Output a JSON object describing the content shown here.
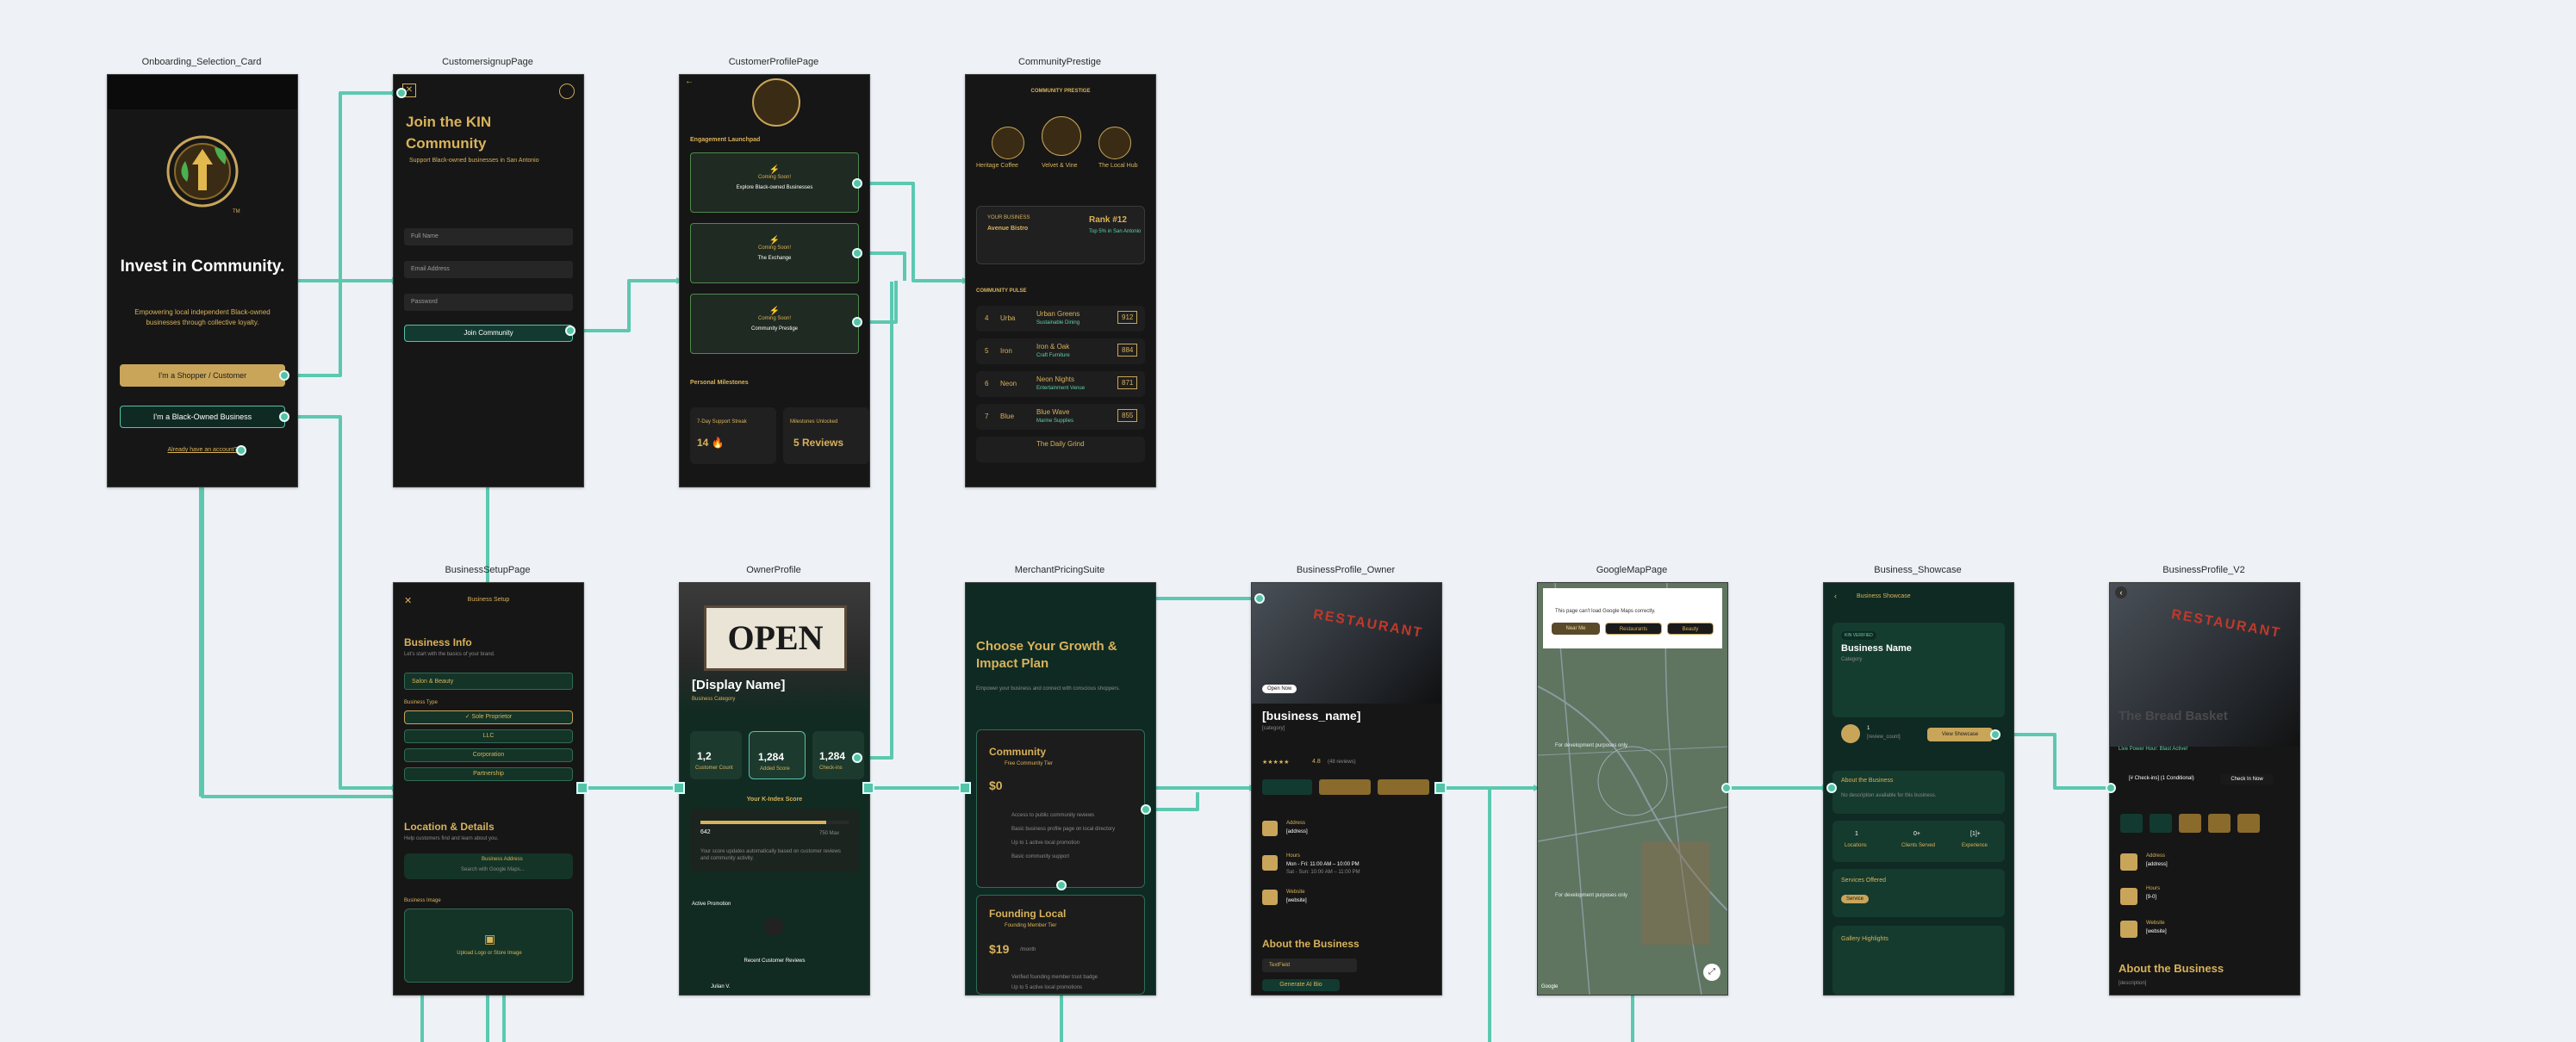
{
  "screens": {
    "onboarding": {
      "title": "Onboarding_Selection_Card",
      "headline": "Invest in Community.",
      "sub": "Empowering local independent Black-owned businesses through collective loyalty.",
      "btn_shopper": "I'm a Shopper / Customer",
      "btn_business": "I'm a Black-Owned Business",
      "link_account": "Already have an account?",
      "logo_mark": "TM"
    },
    "signup": {
      "title": "CustomersignupPage",
      "headline": "Join the KIN Community",
      "sub": "Support Black-owned businesses in San Antonio",
      "field_name": "Full Name",
      "field_email": "Email Address",
      "field_password": "Password",
      "btn_join": "Join Community"
    },
    "customer_profile": {
      "title": "CustomerProfilePage",
      "section_engagement": "Engagement Launchpad",
      "cards": [
        {
          "soon": "Coming Soon!",
          "label": "Explore Black-owned Businesses"
        },
        {
          "soon": "Coming Soon!",
          "label": "The Exchange"
        },
        {
          "soon": "Coming Soon!",
          "label": "Community Prestige"
        }
      ],
      "section_milestones": "Personal Milestones",
      "streak_label": "7-Day Support Streak",
      "streak_value": "14 🔥",
      "milestone_label": "Milestones Unlocked",
      "milestone_value": "5 Reviews"
    },
    "prestige": {
      "title": "CommunityPrestige",
      "header": "COMMUNITY PRESTIGE",
      "podium": [
        "Heritage Coffee",
        "Velvet & Vine",
        "The Local Hub"
      ],
      "your_business_label": "YOUR BUSINESS",
      "your_business": "Avenue Bistro",
      "rank": "Rank #12",
      "rank_sub": "Top 5% in San Antonio",
      "pulse_title": "COMMUNITY PULSE",
      "pulse": [
        {
          "rank": "4",
          "short": "Urba",
          "name": "Urban Greens",
          "cat": "Sustainable Dining",
          "score": "912"
        },
        {
          "rank": "5",
          "short": "Iron",
          "name": "Iron & Oak",
          "cat": "Craft Furniture",
          "score": "884"
        },
        {
          "rank": "6",
          "short": "Neon",
          "name": "Neon Nights",
          "cat": "Entertainment Venue",
          "score": "871"
        },
        {
          "rank": "7",
          "short": "Blue",
          "name": "Blue Wave",
          "cat": "Marine Supplies",
          "score": "855"
        }
      ],
      "pulse_more": "The Daily Grind"
    },
    "setup": {
      "title": "BusinessSetupPage",
      "header": "Business Setup",
      "section_info": "Business Info",
      "info_sub": "Let's start with the basics of your brand.",
      "category": "Salon & Beauty",
      "type_label": "Business Type",
      "types": [
        "✓ Sole Proprietor",
        "LLC",
        "Corporation",
        "Partnership"
      ],
      "section_location": "Location & Details",
      "location_sub": "Help customers find and learn about you.",
      "address_label": "Business Address",
      "address_placeholder": "Search with Google Maps...",
      "image_label": "Business Image",
      "upload": "Upload Logo or Store Image"
    },
    "owner": {
      "title": "OwnerProfile",
      "display_name": "[Display Name]",
      "category": "Business Category",
      "stats": [
        {
          "value": "1,2",
          "label": "Customer Count"
        },
        {
          "value": "1,284",
          "label": "Added Score"
        },
        {
          "value": "1,284",
          "label": "Check-ins"
        }
      ],
      "kindex_title": "Your K-Index Score",
      "kindex_value": "642",
      "kindex_max": "750 Max",
      "kindex_note": "Your score updates automatically based on customer reviews and community activity.",
      "promo": "Active Promotion",
      "reviews": "Recent Customer Reviews",
      "reviewer": "Julian V."
    },
    "pricing": {
      "title": "MerchantPricingSuite",
      "headline": "Choose Your Growth & Impact Plan",
      "sub": "Empower your business and connect with conscious shoppers.",
      "plan1": "Community",
      "plan1_tag": "Free Community Tier",
      "plan1_price": "$0",
      "plan1_features": [
        "Access to public community reviews",
        "Basic business profile page on local directory",
        "Up to 1 active local promotion",
        "Basic community support"
      ],
      "plan2": "Founding Local",
      "plan2_tag": "Founding Member Tier",
      "plan2_price": "$19",
      "plan2_period": "/month",
      "plan2_features": [
        "Verified founding member trust badge",
        "Up to 5 active local promotions"
      ]
    },
    "biz_owner": {
      "title": "BusinessProfile_Owner",
      "status": "Open Now",
      "name": "[business_name]",
      "category": "[category]",
      "rating": "4.8",
      "reviews": "(48 reviews)",
      "address_label": "Address",
      "address": "[address]",
      "hours_label": "Hours",
      "hours1": "Mon - Fri: 11:00 AM – 10:00 PM",
      "hours2": "Sat - Sun: 10:00 AM – 11:00 PM",
      "website_label": "Website",
      "website": "[website]",
      "about": "About the Business",
      "about_field": "TextField",
      "ai_btn": "Generate AI Bio"
    },
    "map": {
      "title": "GoogleMapPage",
      "error": "This page can't load Google Maps correctly.",
      "filters": [
        "Near Me",
        "Restaurants",
        "Beauty"
      ],
      "watermark": "For development purposes only",
      "attribution": "Google"
    },
    "showcase": {
      "title": "Business_Showcase",
      "header": "Business Showcase",
      "badge": "KIN VERIFIED",
      "name": "Business Name",
      "category": "Category",
      "review_count": "1",
      "review_label": "[review_count]",
      "view_btn": "View Showcase",
      "about": "About the Business",
      "about_text": "No description available for this business.",
      "stats": [
        {
          "value": "1",
          "label": "Locations"
        },
        {
          "value": "0+",
          "label": "Clients Served"
        },
        {
          "value": "[1]+",
          "label": "Experience"
        }
      ],
      "services": "Services Offered",
      "service_chip": "Service",
      "gallery": "Gallery Highlights"
    },
    "biz_v2": {
      "title": "BusinessProfile_V2",
      "name": "The Bread Basket",
      "live": "Live Power Hour: Blast Active!",
      "checkin_count": "[# Check-ins] (1 Conditional)",
      "checkin_btn": "Check In Now",
      "address_label": "Address",
      "address": "[address]",
      "hours_label": "Hours",
      "hours": "[9-0]",
      "website_label": "Website",
      "website": "[website]",
      "about": "About the Business",
      "description": "[description]"
    }
  },
  "colors": {
    "accent": "#55c3a8",
    "gold": "#d9b25a",
    "bg": "#eef2f7"
  }
}
